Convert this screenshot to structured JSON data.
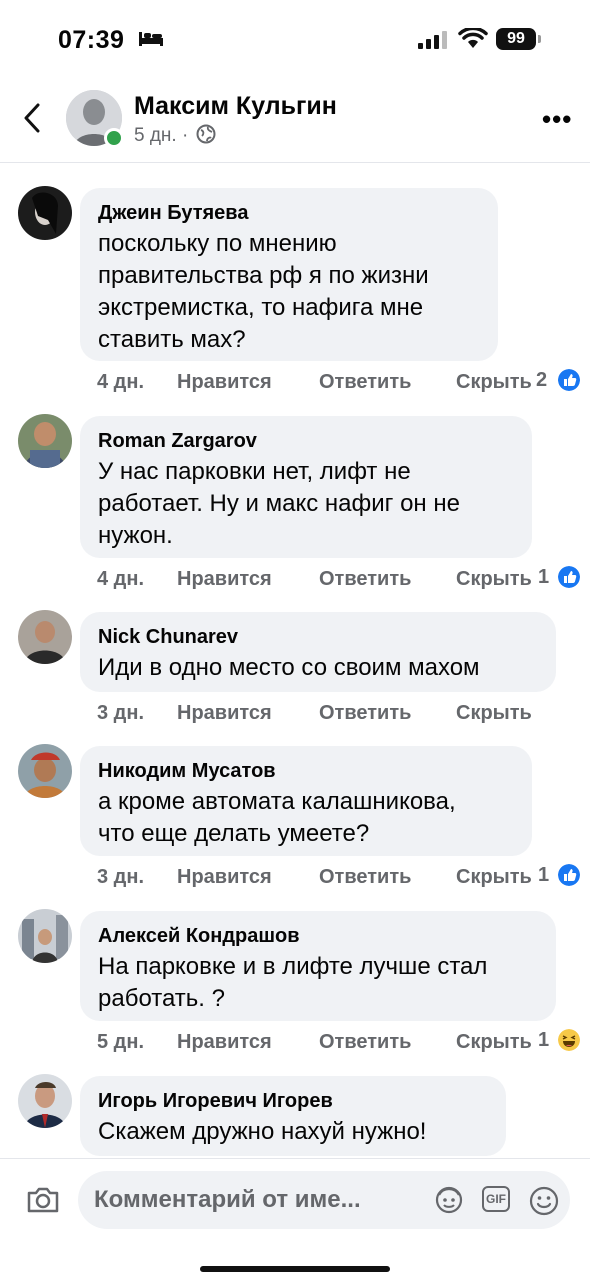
{
  "status_bar": {
    "time": "07:39",
    "battery": "99"
  },
  "header": {
    "name": "Максим Кульгин",
    "meta": "5 дн. ·",
    "back_icon": "chevron-left-icon",
    "privacy_icon": "globe-icon",
    "more_label": "•••"
  },
  "comments": [
    {
      "author": "Джеин Бутяева",
      "text_lines": [
        "поскольку по мнению",
        "правительства рф я по жизни",
        "экстремистка, то нафига мне",
        "ставить мах?"
      ],
      "age": "4 дн.",
      "like": "Нравится",
      "reply": "Ответить",
      "hide": "Скрыть",
      "reaction_count": "2",
      "reaction": "like"
    },
    {
      "author": "Roman Zargarov",
      "text_lines": [
        "У нас парковки нет, лифт не",
        "работает. Ну и макс нафиг он не",
        "нужон."
      ],
      "age": "4 дн.",
      "like": "Нравится",
      "reply": "Ответить",
      "hide": "Скрыть",
      "reaction_count": "1",
      "reaction": "like"
    },
    {
      "author": "Nick Chunarev",
      "text_lines": [
        "Иди в одно место со своим махом"
      ],
      "age": "3 дн.",
      "like": "Нравится",
      "reply": "Ответить",
      "hide": "Скрыть",
      "reaction_count": "",
      "reaction": ""
    },
    {
      "author": "Никодим Мусатов",
      "text_lines": [
        "а кроме автомата калашникова,",
        "что еще делать умеете?"
      ],
      "age": "3 дн.",
      "like": "Нравится",
      "reply": "Ответить",
      "hide": "Скрыть",
      "reaction_count": "1",
      "reaction": "like"
    },
    {
      "author": "Алексей Кондрашов",
      "text_lines": [
        "На парковке и в лифте лучше стал",
        "работать. ?"
      ],
      "age": "5 дн.",
      "like": "Нравится",
      "reply": "Ответить",
      "hide": "Скрыть",
      "reaction_count": "1",
      "reaction": "haha"
    },
    {
      "author": "Игорь Игоревич Игорев",
      "text_lines": [
        "Скажем дружно нахуй нужно!"
      ],
      "age": "",
      "like": "",
      "reply": "",
      "hide": "",
      "reaction_count": "",
      "reaction": ""
    }
  ],
  "composer": {
    "placeholder": "Комментарий от име...",
    "gif_label": "GIF",
    "icons": [
      "camera-icon",
      "avatar-sticker-icon",
      "gif-icon",
      "emoji-icon"
    ]
  },
  "colors": {
    "like_blue": "#1877f2",
    "online_green": "#31a24c",
    "bubble_gray": "#f0f2f5",
    "secondary_text": "#65676b"
  }
}
